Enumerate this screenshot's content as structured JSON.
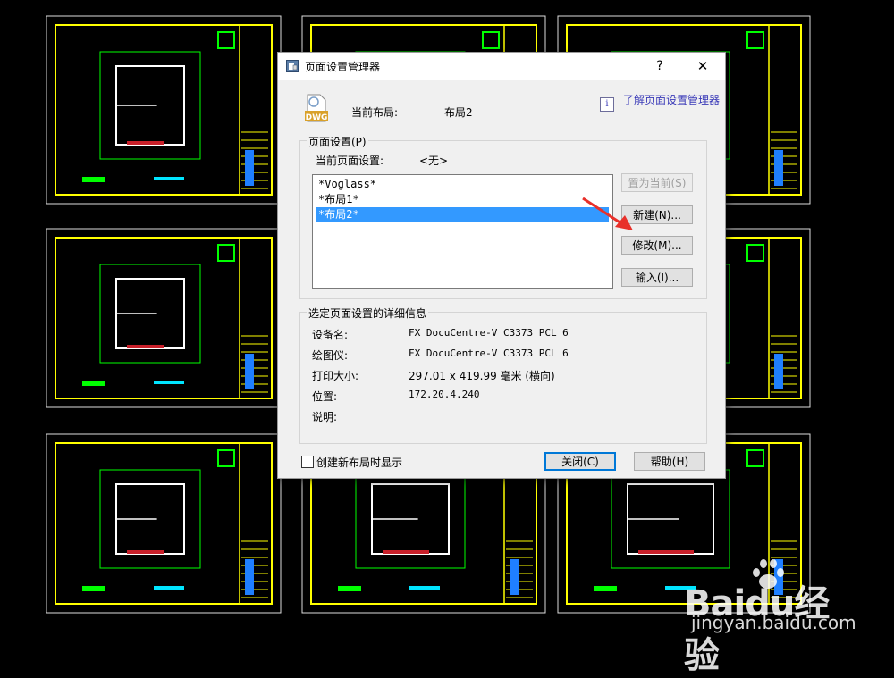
{
  "dialog": {
    "title": "页面设置管理器",
    "help_glyph": "?",
    "close_glyph": "✕",
    "current_layout_label": "当前布局:",
    "current_layout_value": "布局2",
    "dwg_icon_text": "DWG",
    "info_glyph": "i",
    "learn_link": "了解页面设置管理器"
  },
  "page_setup": {
    "group_title": "页面设置(P)",
    "current_label": "当前页面设置:",
    "current_value": "<无>",
    "items": [
      {
        "label": "*Voglass*",
        "selected": false
      },
      {
        "label": "*布局1*",
        "selected": false
      },
      {
        "label": "*布局2*",
        "selected": true
      }
    ],
    "buttons": {
      "set_current": "置为当前(S)",
      "new": "新建(N)...",
      "modify": "修改(M)...",
      "import": "输入(I)..."
    }
  },
  "details": {
    "group_title": "选定页面设置的详细信息",
    "rows": [
      {
        "label": "设备名:",
        "value": "FX DocuCentre-V C3373 PCL 6"
      },
      {
        "label": "绘图仪:",
        "value": "FX DocuCentre-V C3373 PCL 6"
      },
      {
        "label": "打印大小:",
        "value": "297.01 x 419.99 毫米 (横向)"
      },
      {
        "label": "位置:",
        "value": "172.20.4.240"
      },
      {
        "label": "说明:",
        "value": ""
      }
    ]
  },
  "footer": {
    "checkbox_label": "创建新布局时显示",
    "checkbox_checked": false,
    "close_button": "关闭(C)",
    "help_button": "帮助(H)"
  },
  "watermark": {
    "brand": "Baidu经验",
    "url": "jingyan.baidu.com"
  },
  "colors": {
    "cad_background": "#000000",
    "cad_yellow": "#ffff00",
    "cad_green": "#00ff00",
    "selection": "#3399ff",
    "arrow": "#e8302a",
    "link": "#3a3ab8"
  }
}
